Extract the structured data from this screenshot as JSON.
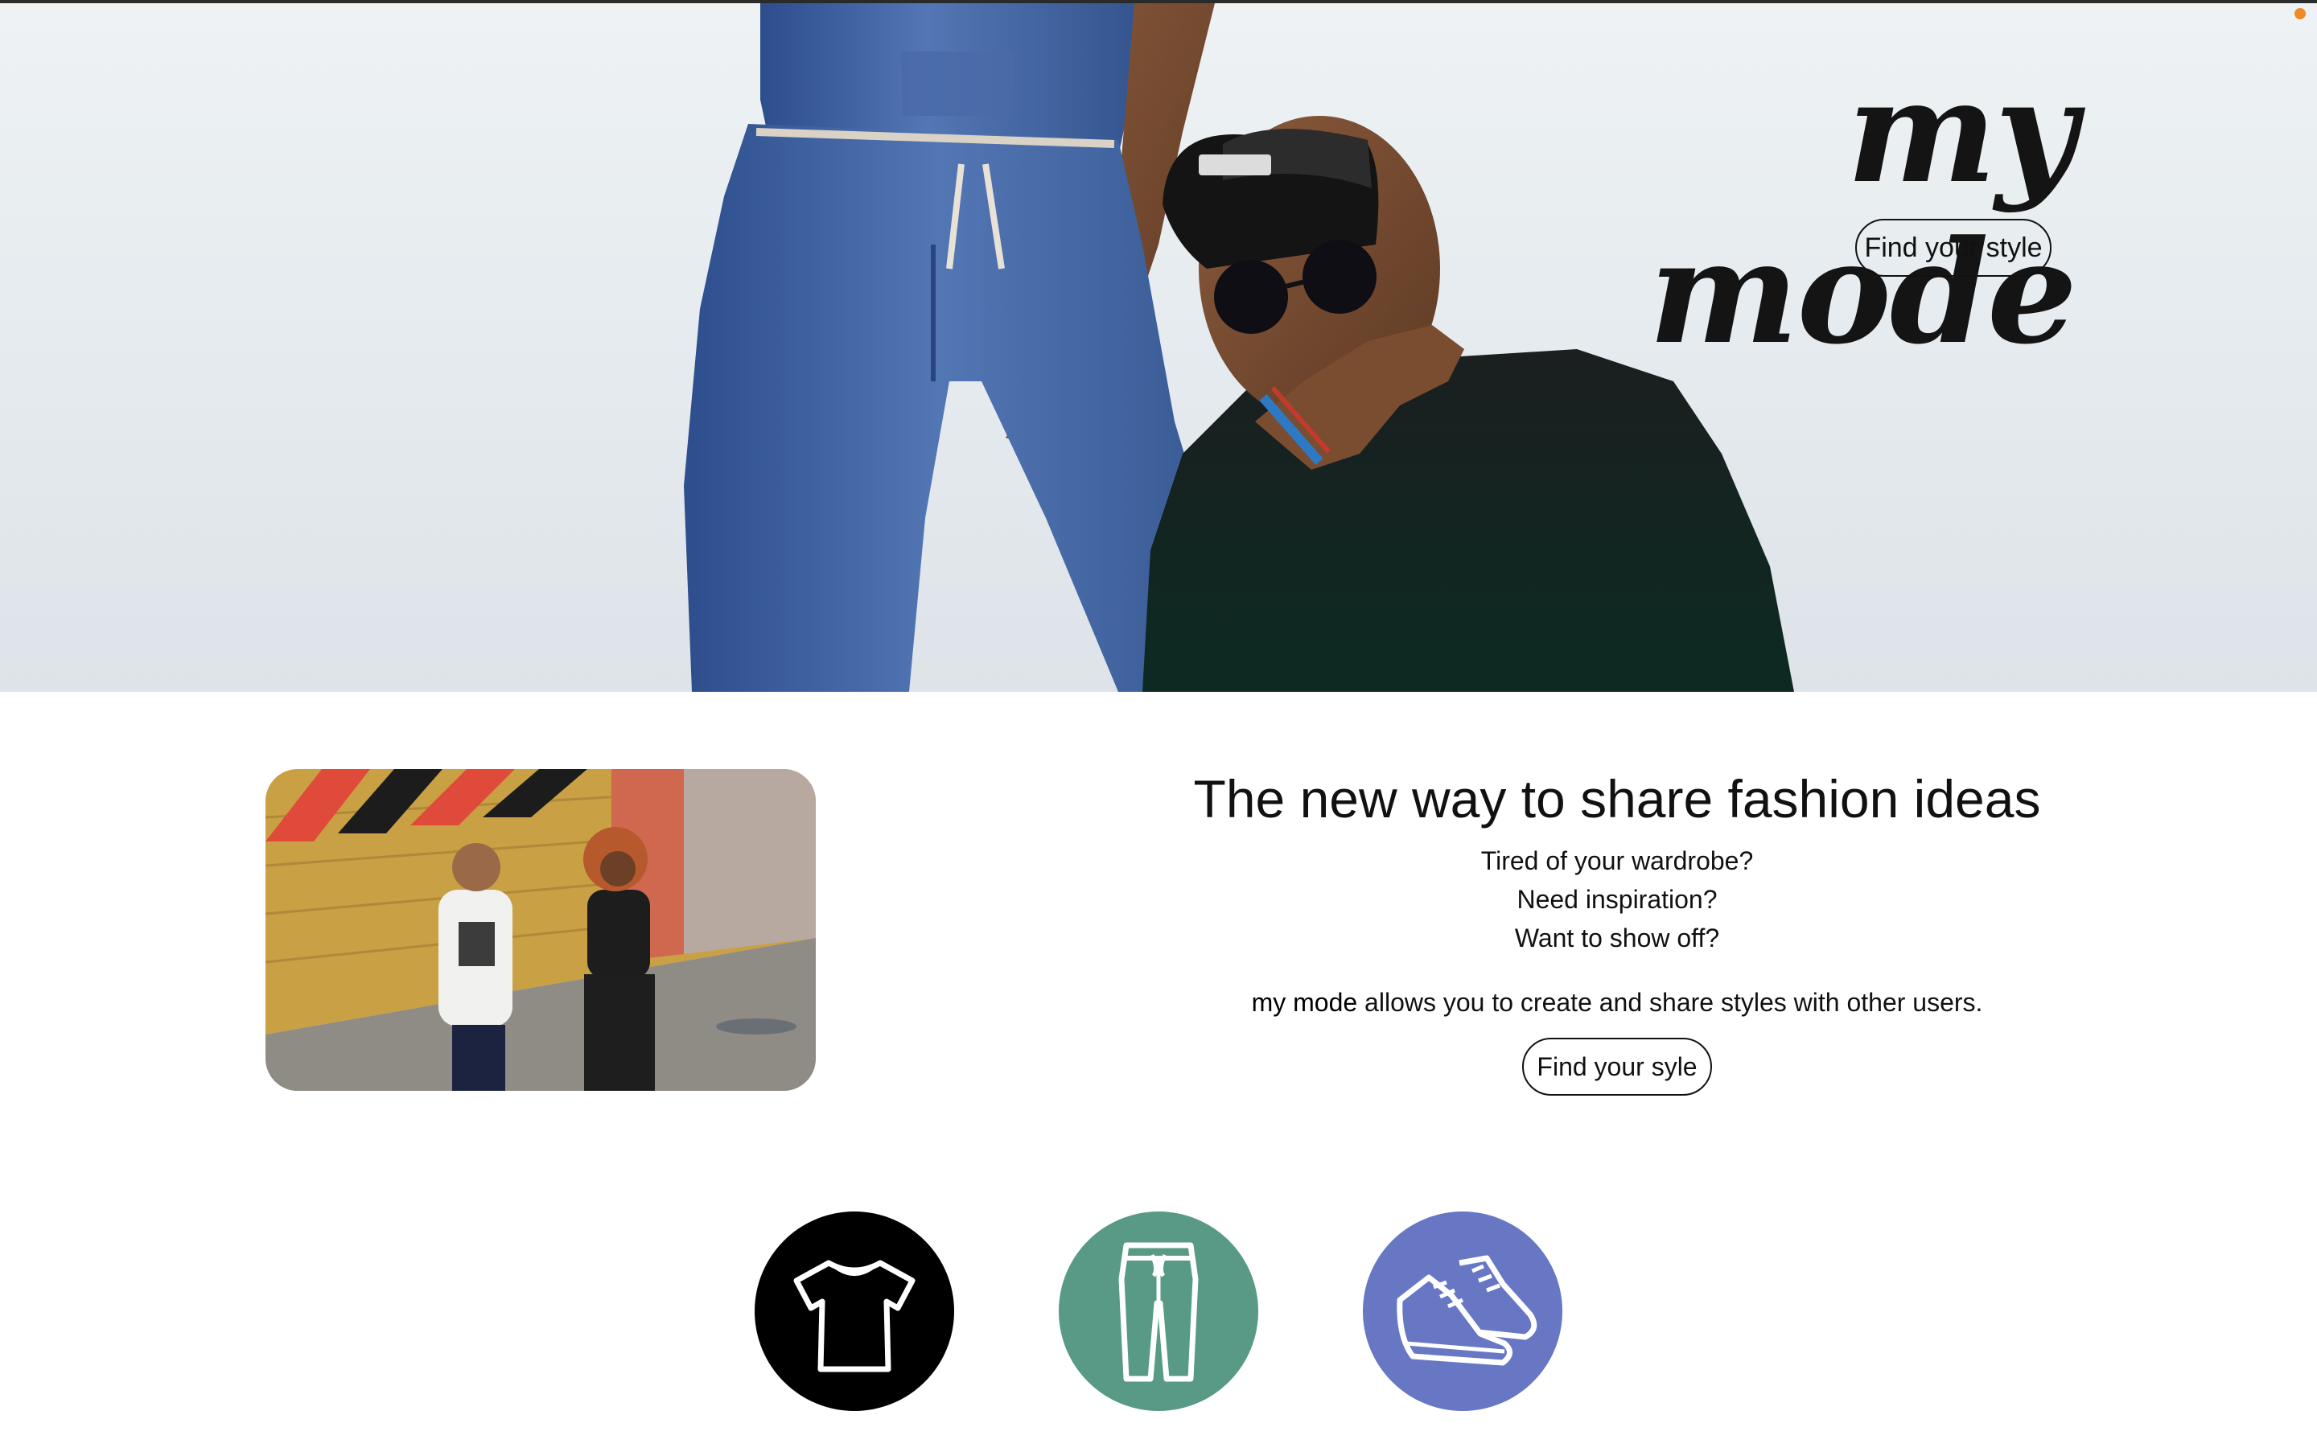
{
  "hero": {
    "logo": "my mode",
    "button_label": "Find your style"
  },
  "intro": {
    "headline": "The new way to share fashion ideas",
    "questions": [
      "Tired of your wardrobe?",
      "Need inspiration?",
      "Want to show off?"
    ],
    "tagline_brand": "my mode",
    "tagline_rest": " allows you to create and share styles with other users.",
    "button_label": "Find your syle"
  },
  "categories": [
    {
      "icon": "tshirt-icon",
      "color": "#000000"
    },
    {
      "icon": "pants-icon",
      "color": "#589a85"
    },
    {
      "icon": "sneakers-icon",
      "color": "#6777c4"
    }
  ],
  "colors": {
    "accent_orange": "#f08a24",
    "text": "#111111"
  }
}
